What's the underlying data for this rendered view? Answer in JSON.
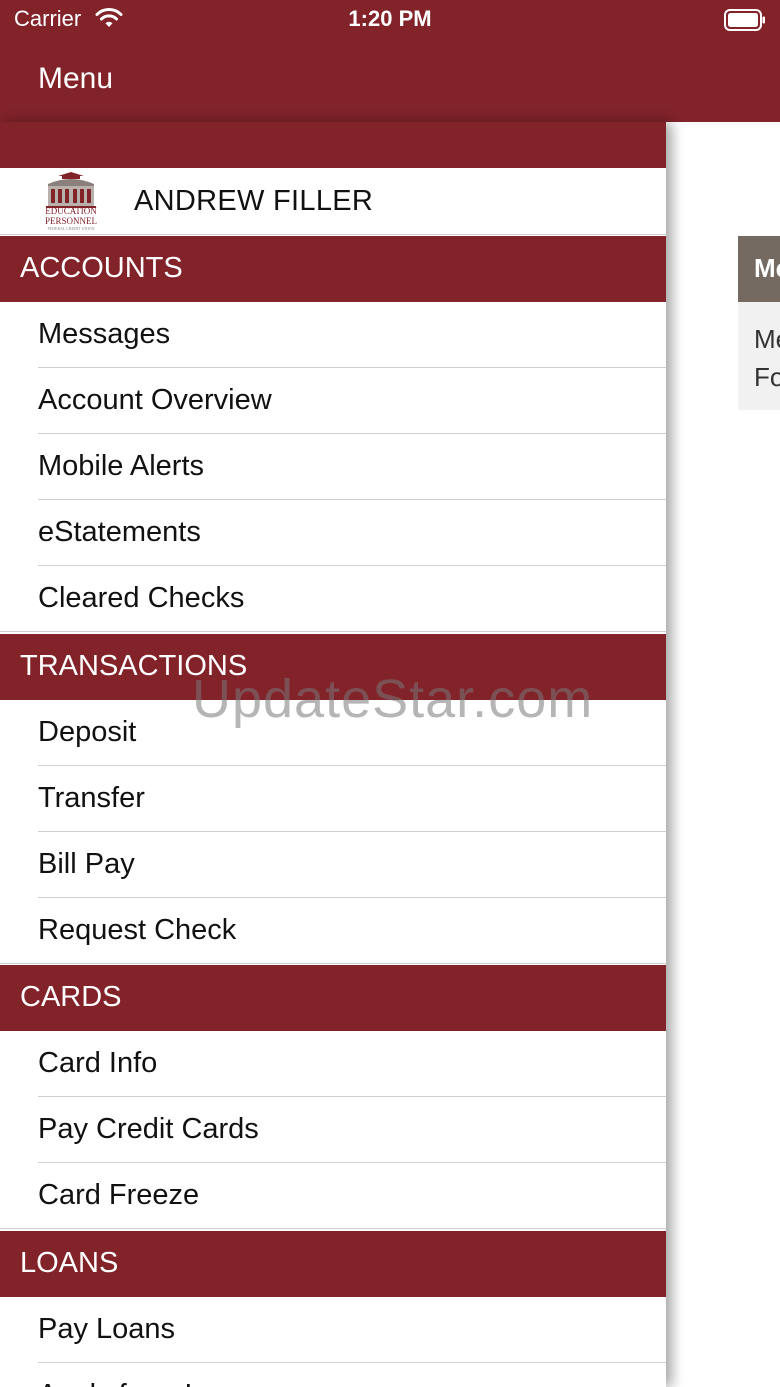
{
  "status_bar": {
    "carrier": "Carrier",
    "time": "1:20 PM"
  },
  "nav": {
    "title": "Menu"
  },
  "user": {
    "name": "ANDREW FILLER"
  },
  "logo": {
    "lines": [
      "EDUCATION",
      "PERSONNEL",
      "FEDERAL CREDIT UNION"
    ]
  },
  "sections": [
    {
      "header": "ACCOUNTS",
      "items": [
        "Messages",
        "Account Overview",
        "Mobile Alerts",
        "eStatements",
        "Cleared Checks"
      ]
    },
    {
      "header": "TRANSACTIONS",
      "items": [
        "Deposit",
        "Transfer",
        "Bill Pay",
        "Request Check"
      ]
    },
    {
      "header": "CARDS",
      "items": [
        "Card Info",
        "Pay Credit Cards",
        "Card Freeze"
      ]
    },
    {
      "header": "LOANS",
      "items": [
        "Pay Loans",
        "Apply for a Loan"
      ]
    }
  ],
  "content_card": {
    "header": "Me",
    "lines": [
      "Me",
      "Fo"
    ]
  },
  "watermark": "UpdateStar.com",
  "colors": {
    "brand": "#82232a",
    "card_header": "#756a62"
  }
}
